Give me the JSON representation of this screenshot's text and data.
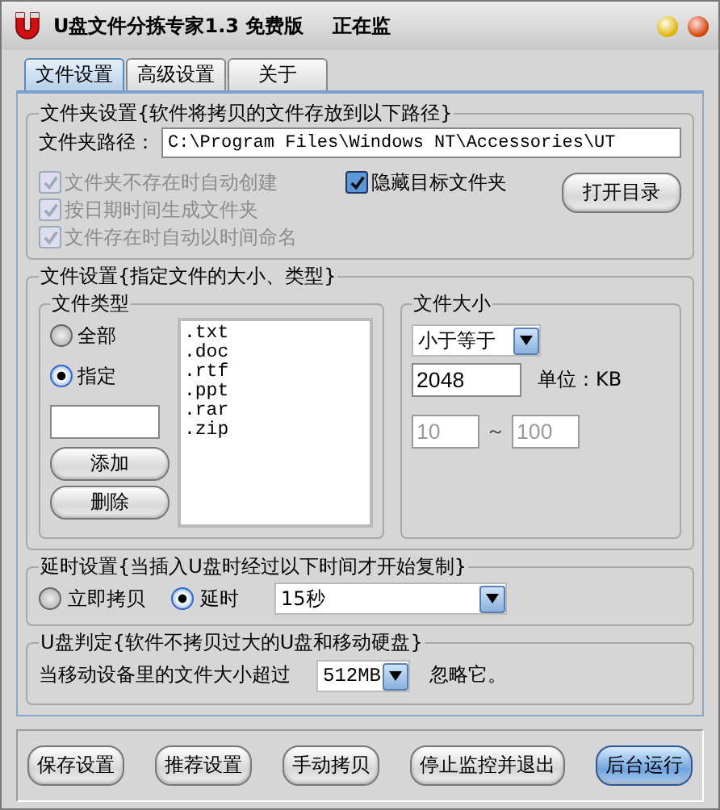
{
  "window": {
    "title": "U盘文件分拣专家1.3 免费版",
    "status": "正在监"
  },
  "tabs": [
    {
      "label": "文件设置",
      "selected": true
    },
    {
      "label": "高级设置",
      "selected": false
    },
    {
      "label": "关于",
      "selected": false
    }
  ],
  "folder_settings": {
    "title": "文件夹设置{软件将拷贝的文件存放到以下路径}",
    "path_label": "文件夹路径：",
    "path": "C:\\Program Files\\Windows NT\\Accessories\\UT",
    "options": [
      {
        "label": "文件夹不存在时自动创建",
        "checked": true,
        "disabled": true
      },
      {
        "label": "按日期时间生成文件夹",
        "checked": true,
        "disabled": true
      },
      {
        "label": "文件存在时自动以时间命名",
        "checked": true,
        "disabled": true
      }
    ],
    "hide_folder": {
      "label": "隐藏目标文件夹",
      "checked": true,
      "disabled": false
    },
    "open_button": "打开目录"
  },
  "file_settings": {
    "title": "文件设置{指定文件的大小、类型}",
    "type_group": {
      "title": "文件类型",
      "choices": [
        {
          "label": "全部",
          "selected": false
        },
        {
          "label": "指定",
          "selected": true
        }
      ],
      "add_button": "添加",
      "delete_button": "删除",
      "extensions": [
        ".txt",
        ".doc",
        ".rtf",
        ".ppt",
        ".rar",
        ".zip"
      ]
    },
    "size_group": {
      "title": "文件大小",
      "comparison": "小于等于",
      "size": "2048",
      "unit": "单位：KB",
      "range_from": "10",
      "range_sep": "～",
      "range_to": "100",
      "range_disabled": true
    }
  },
  "delay": {
    "title": "延时设置{当插入U盘时经过以下时间才开始复制}",
    "choices": [
      {
        "label": "立即拷贝",
        "selected": false
      },
      {
        "label": "延时",
        "selected": true
      }
    ],
    "delay_value": "15秒"
  },
  "usb": {
    "title": "U盘判定{软件不拷贝过大的U盘和移动硬盘}",
    "text": "当移动设备里的文件大小超过",
    "limit": "512MB",
    "suffix": "忽略它。"
  },
  "buttons": [
    {
      "label": "保存设置",
      "primary": false
    },
    {
      "label": "推荐设置",
      "primary": false
    },
    {
      "label": "手动拷贝",
      "primary": false
    },
    {
      "label": "停止监控并退出",
      "primary": false
    },
    {
      "label": "后台运行",
      "primary": true
    }
  ]
}
